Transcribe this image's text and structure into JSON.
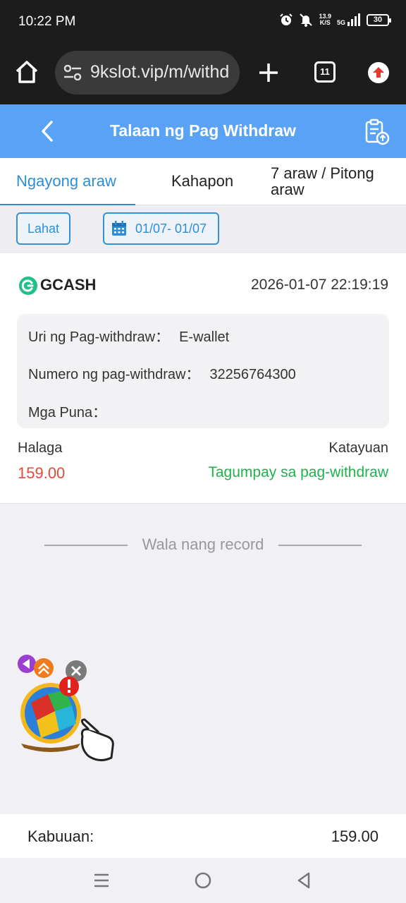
{
  "status_bar": {
    "time": "10:22 PM",
    "net_speed_value": "13.9",
    "net_speed_unit": "K/S",
    "network": "5G",
    "battery": "30",
    "icons": [
      "alarm-icon",
      "mute-icon",
      "signal-icon",
      "battery-icon"
    ]
  },
  "browser": {
    "url": "9kslot.vip/m/withd",
    "tab_count": "11",
    "icons": [
      "home-icon",
      "site-settings-icon",
      "new-tab-icon",
      "tabs-icon",
      "update-icon"
    ]
  },
  "header": {
    "title": "Talaan ng Pag Withdraw",
    "icons": [
      "back-icon",
      "clipboard-upload-icon"
    ],
    "color": "#5aa2f5"
  },
  "tabs": [
    {
      "label": "Ngayong araw",
      "active": true
    },
    {
      "label": "Kahapon",
      "active": false
    },
    {
      "label": "7 araw / Pitong araw",
      "active": false
    }
  ],
  "filters": {
    "all_label": "Lahat",
    "date_range": "01/07- 01/07"
  },
  "record": {
    "method": "GCASH",
    "datetime": "2026-01-07 22:19:19",
    "type_label": "Uri ng Pag-withdraw：",
    "type_value": "E-wallet",
    "number_label": "Numero ng pag-withdraw：",
    "number_value": "32256764300",
    "remarks_label": "Mga Puna：",
    "remarks_value": "",
    "amount_label": "Halaga",
    "amount_value": "159.00",
    "status_label": "Katayuan",
    "status_value": "Tagumpay sa pag-withdraw",
    "amount_color": "#e04a3a",
    "status_color": "#22b14c"
  },
  "no_record_text": "Wala nang record",
  "total": {
    "label": "Kabuuan:",
    "value": "159.00"
  },
  "nav": {
    "icons": [
      "recent-apps-icon",
      "home-circle-icon",
      "back-triangle-icon"
    ]
  },
  "accent": "#2c8ed6"
}
